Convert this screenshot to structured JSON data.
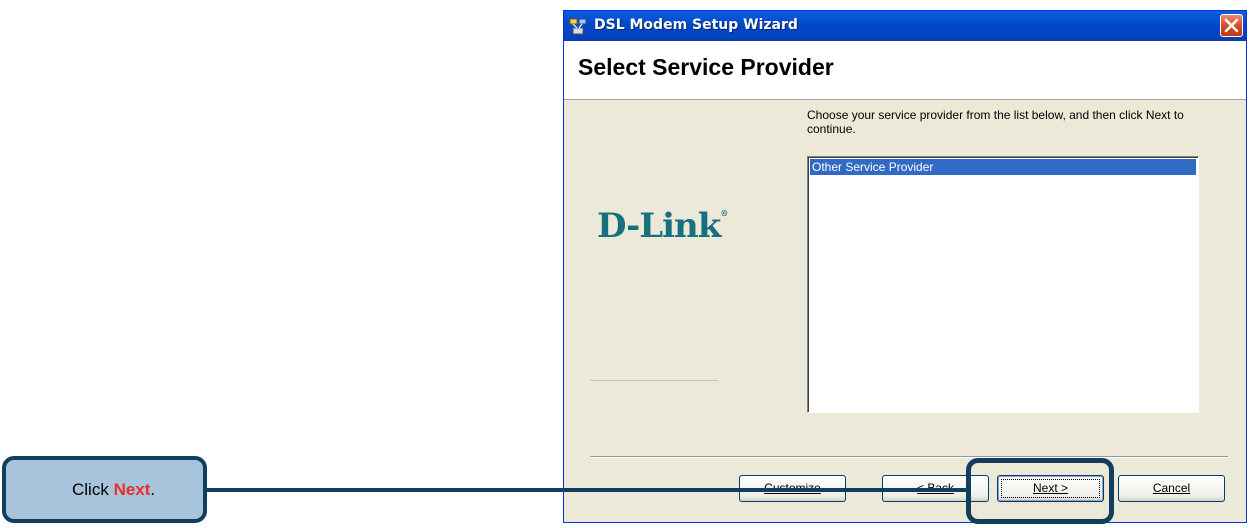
{
  "window": {
    "title": "DSL Modem Setup Wizard",
    "close_icon": "close-icon",
    "app_icon": "network-wizard-icon"
  },
  "header": {
    "title": "Select Service Provider"
  },
  "sidebar": {
    "logo_text": "D-Link",
    "logo_reg": "®",
    "logo_color": "#16707f"
  },
  "main": {
    "instructions": "Choose your service provider from the list below, and then click Next to continue.",
    "providers": [
      {
        "label": "Other Service Provider",
        "selected": true
      }
    ]
  },
  "buttons": {
    "customize": "Customize",
    "back": "< Back",
    "next": "Next >",
    "cancel": "Cancel"
  },
  "callout": {
    "prefix": "Click ",
    "emphasis": "Next",
    "suffix": ".",
    "accent_color": "#e8302b"
  }
}
